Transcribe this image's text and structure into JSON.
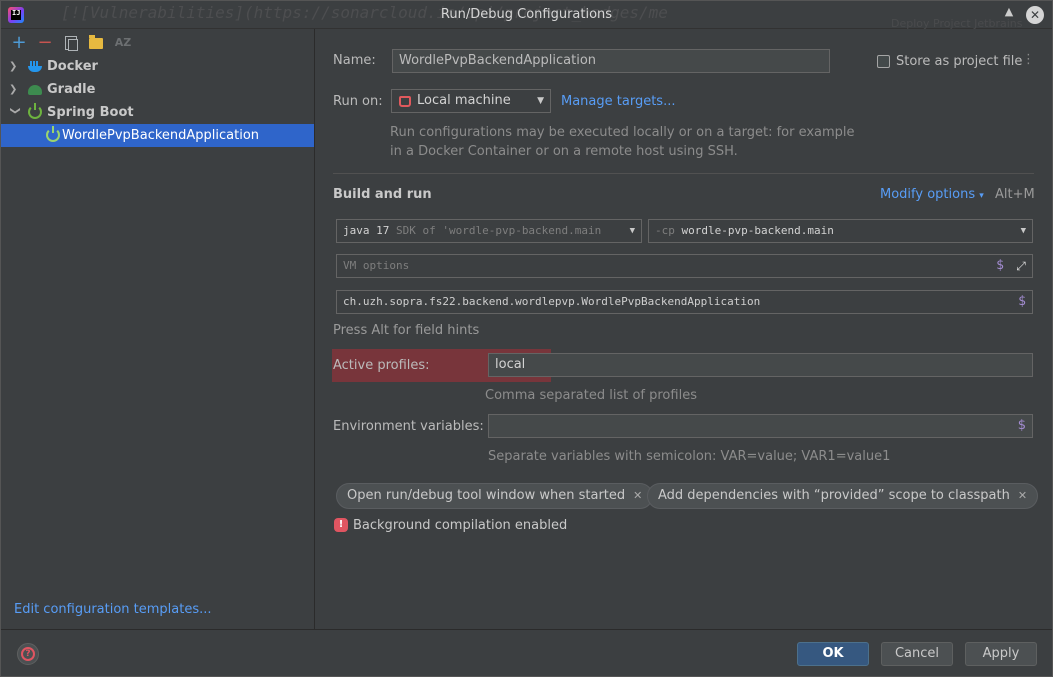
{
  "window": {
    "title": "Run/Debug Configurations",
    "background_text": "[![Vulnerabilities](https://sonarcloud.io/api/project_badges/me",
    "background_text_right": "Deploy Project Jetbrains"
  },
  "left_toolbar": {
    "add": "+",
    "remove": "−",
    "sort": "AZ"
  },
  "tree": {
    "docker": "Docker",
    "gradle": "Gradle",
    "spring_boot": "Spring Boot",
    "selected_config": "WordlePvpBackendApplication"
  },
  "edit_templates_link": "Edit configuration templates...",
  "form": {
    "name_label": "Name:",
    "name_value": "WordlePvpBackendApplication",
    "store_label": "Store as project file",
    "store_checked": false,
    "run_on_label": "Run on:",
    "run_on_value": "Local machine",
    "manage_targets": "Manage targets...",
    "run_on_help_1": "Run configurations may be executed locally or on a target: for example",
    "run_on_help_2": "in a Docker Container or on a remote host using SSH.",
    "build_and_run": "Build and run",
    "modify_options": "Modify options",
    "modify_shortcut": "Alt+M",
    "jdk_value": "java 17",
    "jdk_detail": "SDK of 'wordle-pvp-backend.main",
    "cp_prefix": "-cp",
    "cp_value": "wordle-pvp-backend.main",
    "vm_placeholder": "VM options",
    "main_class": "ch.uzh.sopra.fs22.backend.wordlepvp.WordlePvpBackendApplication",
    "alt_hint": "Press Alt for field hints",
    "profiles_label": "Active profiles:",
    "profiles_value": "local",
    "profiles_hint": "Comma separated list of profiles",
    "env_label": "Environment variables:",
    "env_hint": "Separate variables with semicolon: VAR=value; VAR1=value1",
    "chip_1": "Open run/debug tool window when started",
    "chip_2": "Add dependencies with “provided” scope to classpath",
    "background_compilation": "Background compilation enabled"
  },
  "footer": {
    "ok": "OK",
    "cancel": "Cancel",
    "apply": "Apply"
  },
  "colors": {
    "accent": "#589df6",
    "selection": "#2f65ca",
    "primary_button": "#365880",
    "error": "#e05561"
  }
}
